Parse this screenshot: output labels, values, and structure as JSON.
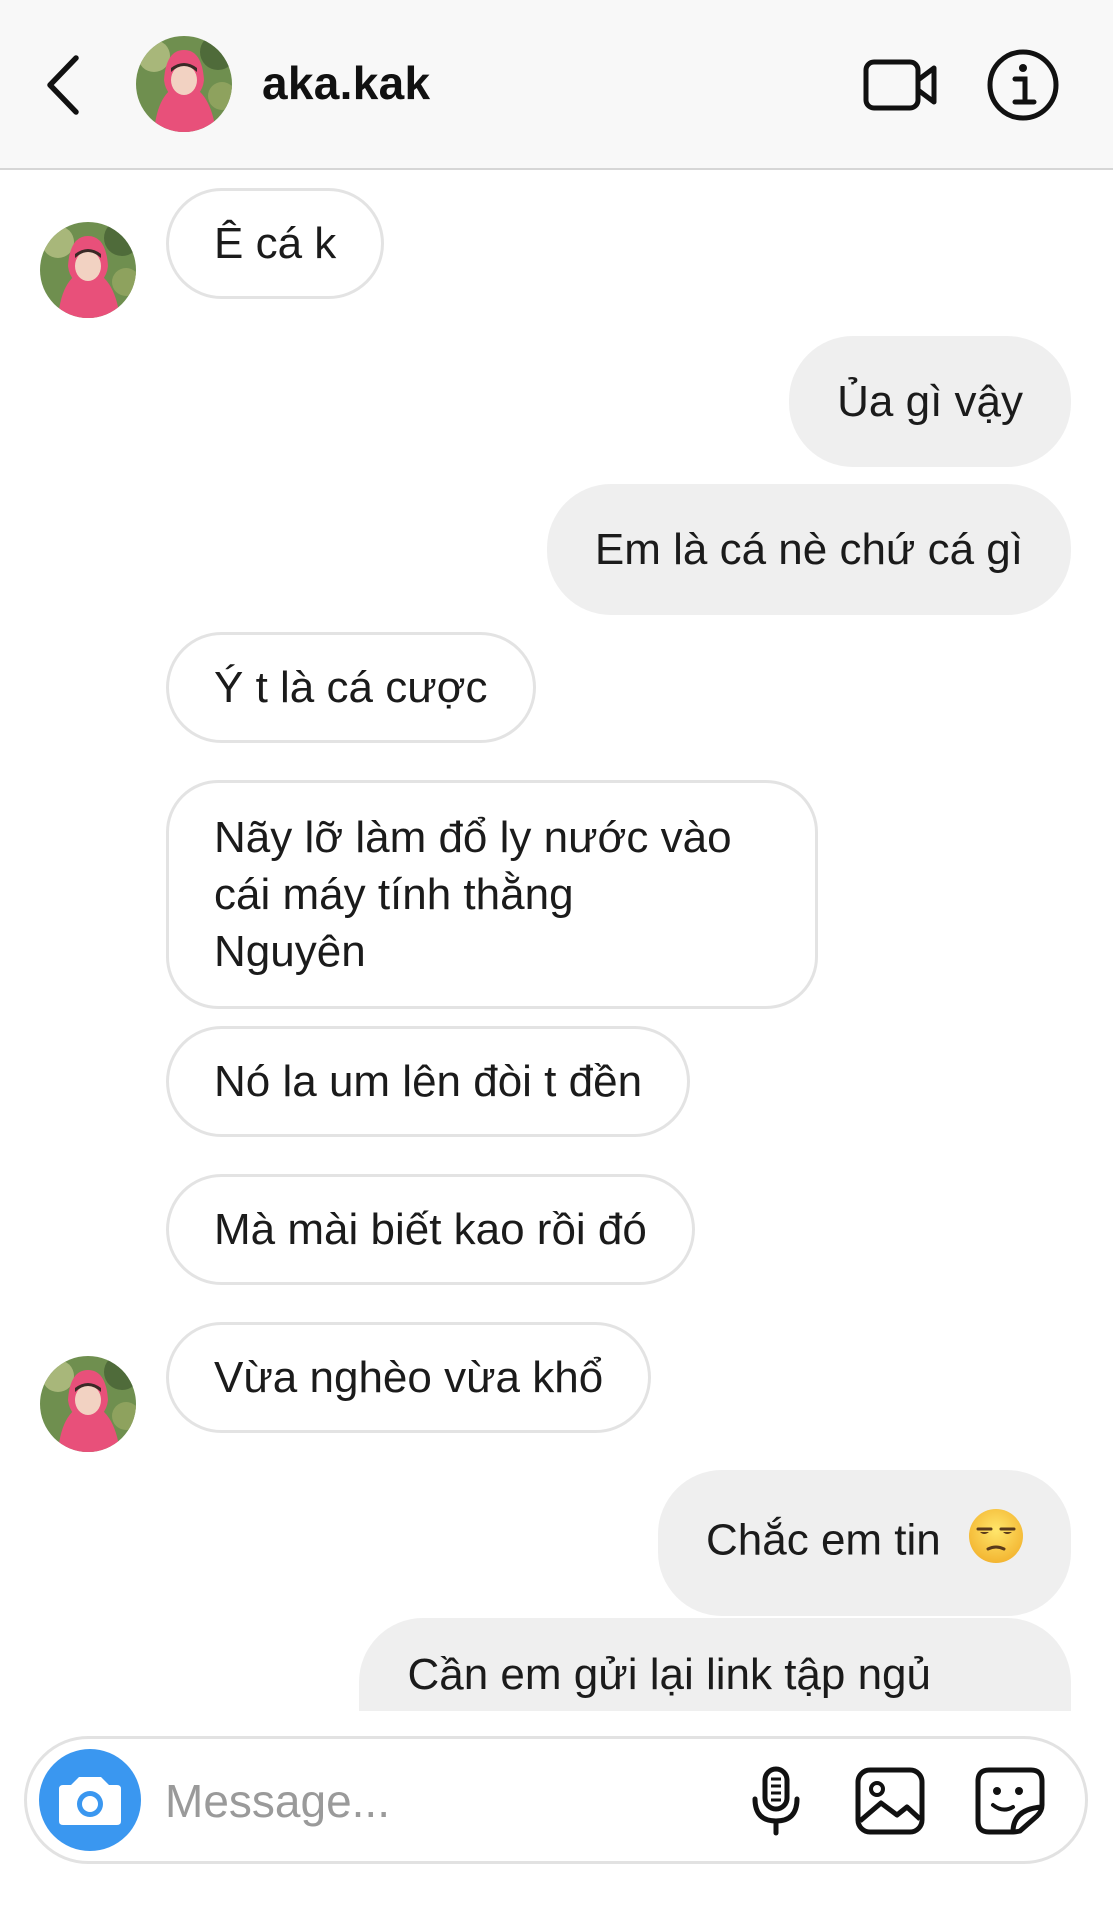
{
  "header": {
    "username": "aka.kak",
    "back_icon": "chevron-left-icon",
    "video_icon": "video-camera-icon",
    "info_icon": "info-icon"
  },
  "messages": [
    {
      "side": "in",
      "text": "Ê cá k"
    },
    {
      "side": "out",
      "text": "Ủa gì vậy"
    },
    {
      "side": "out",
      "text": "Em là cá nè chứ cá gì"
    },
    {
      "side": "in",
      "text": "Ý t là cá cược"
    },
    {
      "side": "in",
      "lines": [
        "Nãy lỡ làm đổ ly nước vào",
        "cái máy tính thằng",
        "Nguyên"
      ]
    },
    {
      "side": "in",
      "text": "Nó la um lên đòi t đền"
    },
    {
      "side": "in",
      "text": "Mà mài biết kao rồi đó"
    },
    {
      "side": "in",
      "text": "Vừa nghèo vừa khổ"
    },
    {
      "side": "out",
      "text": "Chắc em tin",
      "emoji": "unamused-face"
    },
    {
      "side": "out",
      "text": "Cần em gửi lại link tập ngủ"
    }
  ],
  "composer": {
    "placeholder": "Message...",
    "camera_icon": "camera-icon",
    "mic_icon": "microphone-icon",
    "gallery_icon": "gallery-icon",
    "sticker_icon": "sticker-icon"
  },
  "colors": {
    "camera_button": "#3a97f0",
    "outgoing_bubble": "#efefef",
    "incoming_border": "#e3e3e3",
    "header_bg": "#f8f8f8"
  }
}
